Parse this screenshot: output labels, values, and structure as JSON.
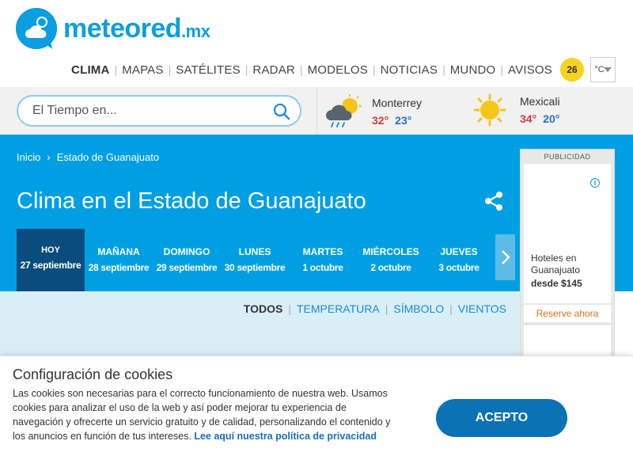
{
  "brand": {
    "name": "meteored",
    "tld": ".mx"
  },
  "nav": {
    "items": [
      {
        "label": "CLIMA",
        "active": true
      },
      {
        "label": "MAPAS"
      },
      {
        "label": "SATÉLITES"
      },
      {
        "label": "RADAR"
      },
      {
        "label": "MODELOS"
      },
      {
        "label": "NOTICIAS"
      },
      {
        "label": "MUNDO"
      },
      {
        "label": "AVISOS"
      }
    ],
    "alerts_count": "26",
    "unit": "°C"
  },
  "search": {
    "placeholder": "El Tiempo en..."
  },
  "cities": [
    {
      "name": "Monterrey",
      "max": "32°",
      "min": "23°",
      "icon": "rain-cloud-sun-icon"
    },
    {
      "name": "Mexicali",
      "max": "34°",
      "min": "20°",
      "icon": "sun-icon"
    }
  ],
  "breadcrumb": {
    "home": "Inicio",
    "current": "Estado de Guanajuato"
  },
  "page": {
    "title": "Clima en el Estado de Guanajuato"
  },
  "days": [
    {
      "name": "HOY",
      "date": "27 septiembre",
      "active": true
    },
    {
      "name": "MAÑANA",
      "date": "28 septiembre"
    },
    {
      "name": "DOMINGO",
      "date": "29 septiembre"
    },
    {
      "name": "LUNES",
      "date": "30 septiembre"
    },
    {
      "name": "MARTES",
      "date": "1 octubre"
    },
    {
      "name": "MIÉRCOLES",
      "date": "2 octubre"
    },
    {
      "name": "JUEVES",
      "date": "3 octubre"
    }
  ],
  "ad": {
    "label": "PUBLICIDAD",
    "text_line1": "Hoteles en",
    "text_line2": "Guanajuato",
    "price": "desde $145",
    "cta": "Reserve ahora"
  },
  "filters": [
    {
      "label": "TODOS",
      "active": true
    },
    {
      "label": "TEMPERATURA"
    },
    {
      "label": "SÍMBOLO"
    },
    {
      "label": "VIENTOS"
    }
  ],
  "cookie": {
    "title": "Configuración de cookies",
    "text": "Las cookies son necesarias para el correcto funcionamiento de nuestra web. Usamos cookies para analizar el uso de la web y así poder mejorar tu experiencia de navegación y ofrecerte un servicio gratuito y de calidad, personalizando el contenido y los anuncios en función de tus intereses.",
    "link": "Lee aquí nuestra política de privacidad",
    "accept": "ACEPTO"
  },
  "colors": {
    "brand_blue": "#0c9ee0",
    "band_blue": "#009fe3",
    "today_navy": "#0a4c7d",
    "max_temp": "#d9383a",
    "min_temp": "#2a6ec9",
    "accept_button": "#0a72b5"
  }
}
